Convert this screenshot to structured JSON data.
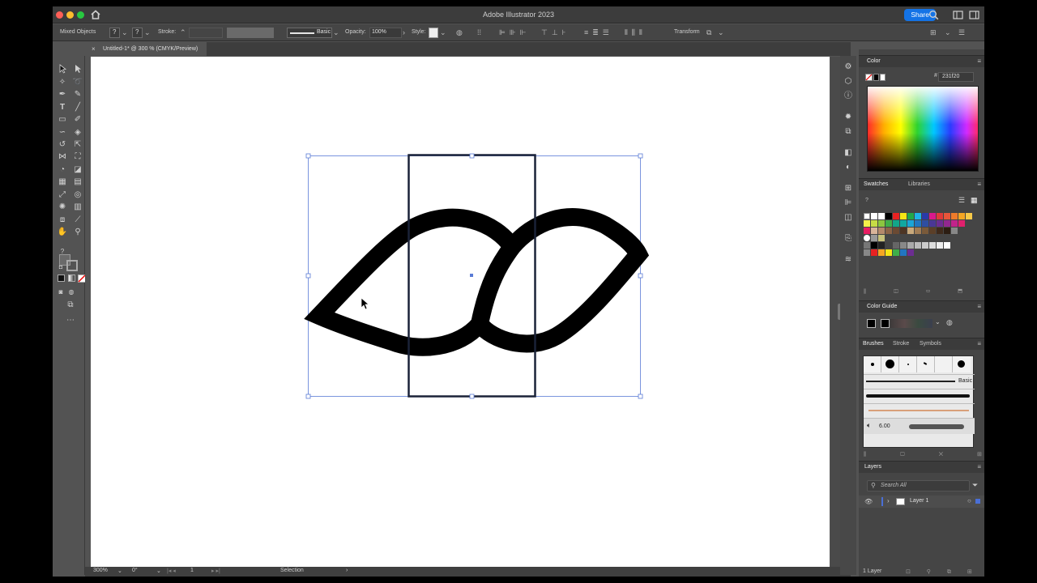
{
  "app": {
    "title": "Adobe Illustrator 2023",
    "share_label": "Share"
  },
  "controlbar": {
    "selection_type": "Mixed Objects",
    "stroke_label": "Stroke:",
    "brush_label": "Basic",
    "opacity_label": "Opacity:",
    "opacity_value": "100%",
    "style_label": "Style:",
    "transform_label": "Transform"
  },
  "document": {
    "tab_title": "Untitled-1* @ 300 % (CMYK/Preview)",
    "close_glyph": "×"
  },
  "status": {
    "zoom": "300%",
    "rotation": "0°",
    "artboard": "1",
    "tool": "Selection"
  },
  "panels": {
    "color": {
      "tab": "Color",
      "hex_prefix": "#",
      "hex": "231f20"
    },
    "swatches": {
      "tab": "Swatches",
      "tab2": "Libraries"
    },
    "color_guide": {
      "tab": "Color Guide"
    },
    "brushes": {
      "tab": "Brushes",
      "tab2": "Stroke",
      "tab3": "Symbols",
      "basic_label": "Basic",
      "size_label": "6.00"
    },
    "layers": {
      "tab": "Layers",
      "search_placeholder": "Search All",
      "layer_name": "Layer 1",
      "footer": "1 Layer"
    }
  },
  "colors": {
    "accent": "#1473e6",
    "selection": "#4a6fd6",
    "path": "#000000",
    "ui_dark": "#535353"
  }
}
